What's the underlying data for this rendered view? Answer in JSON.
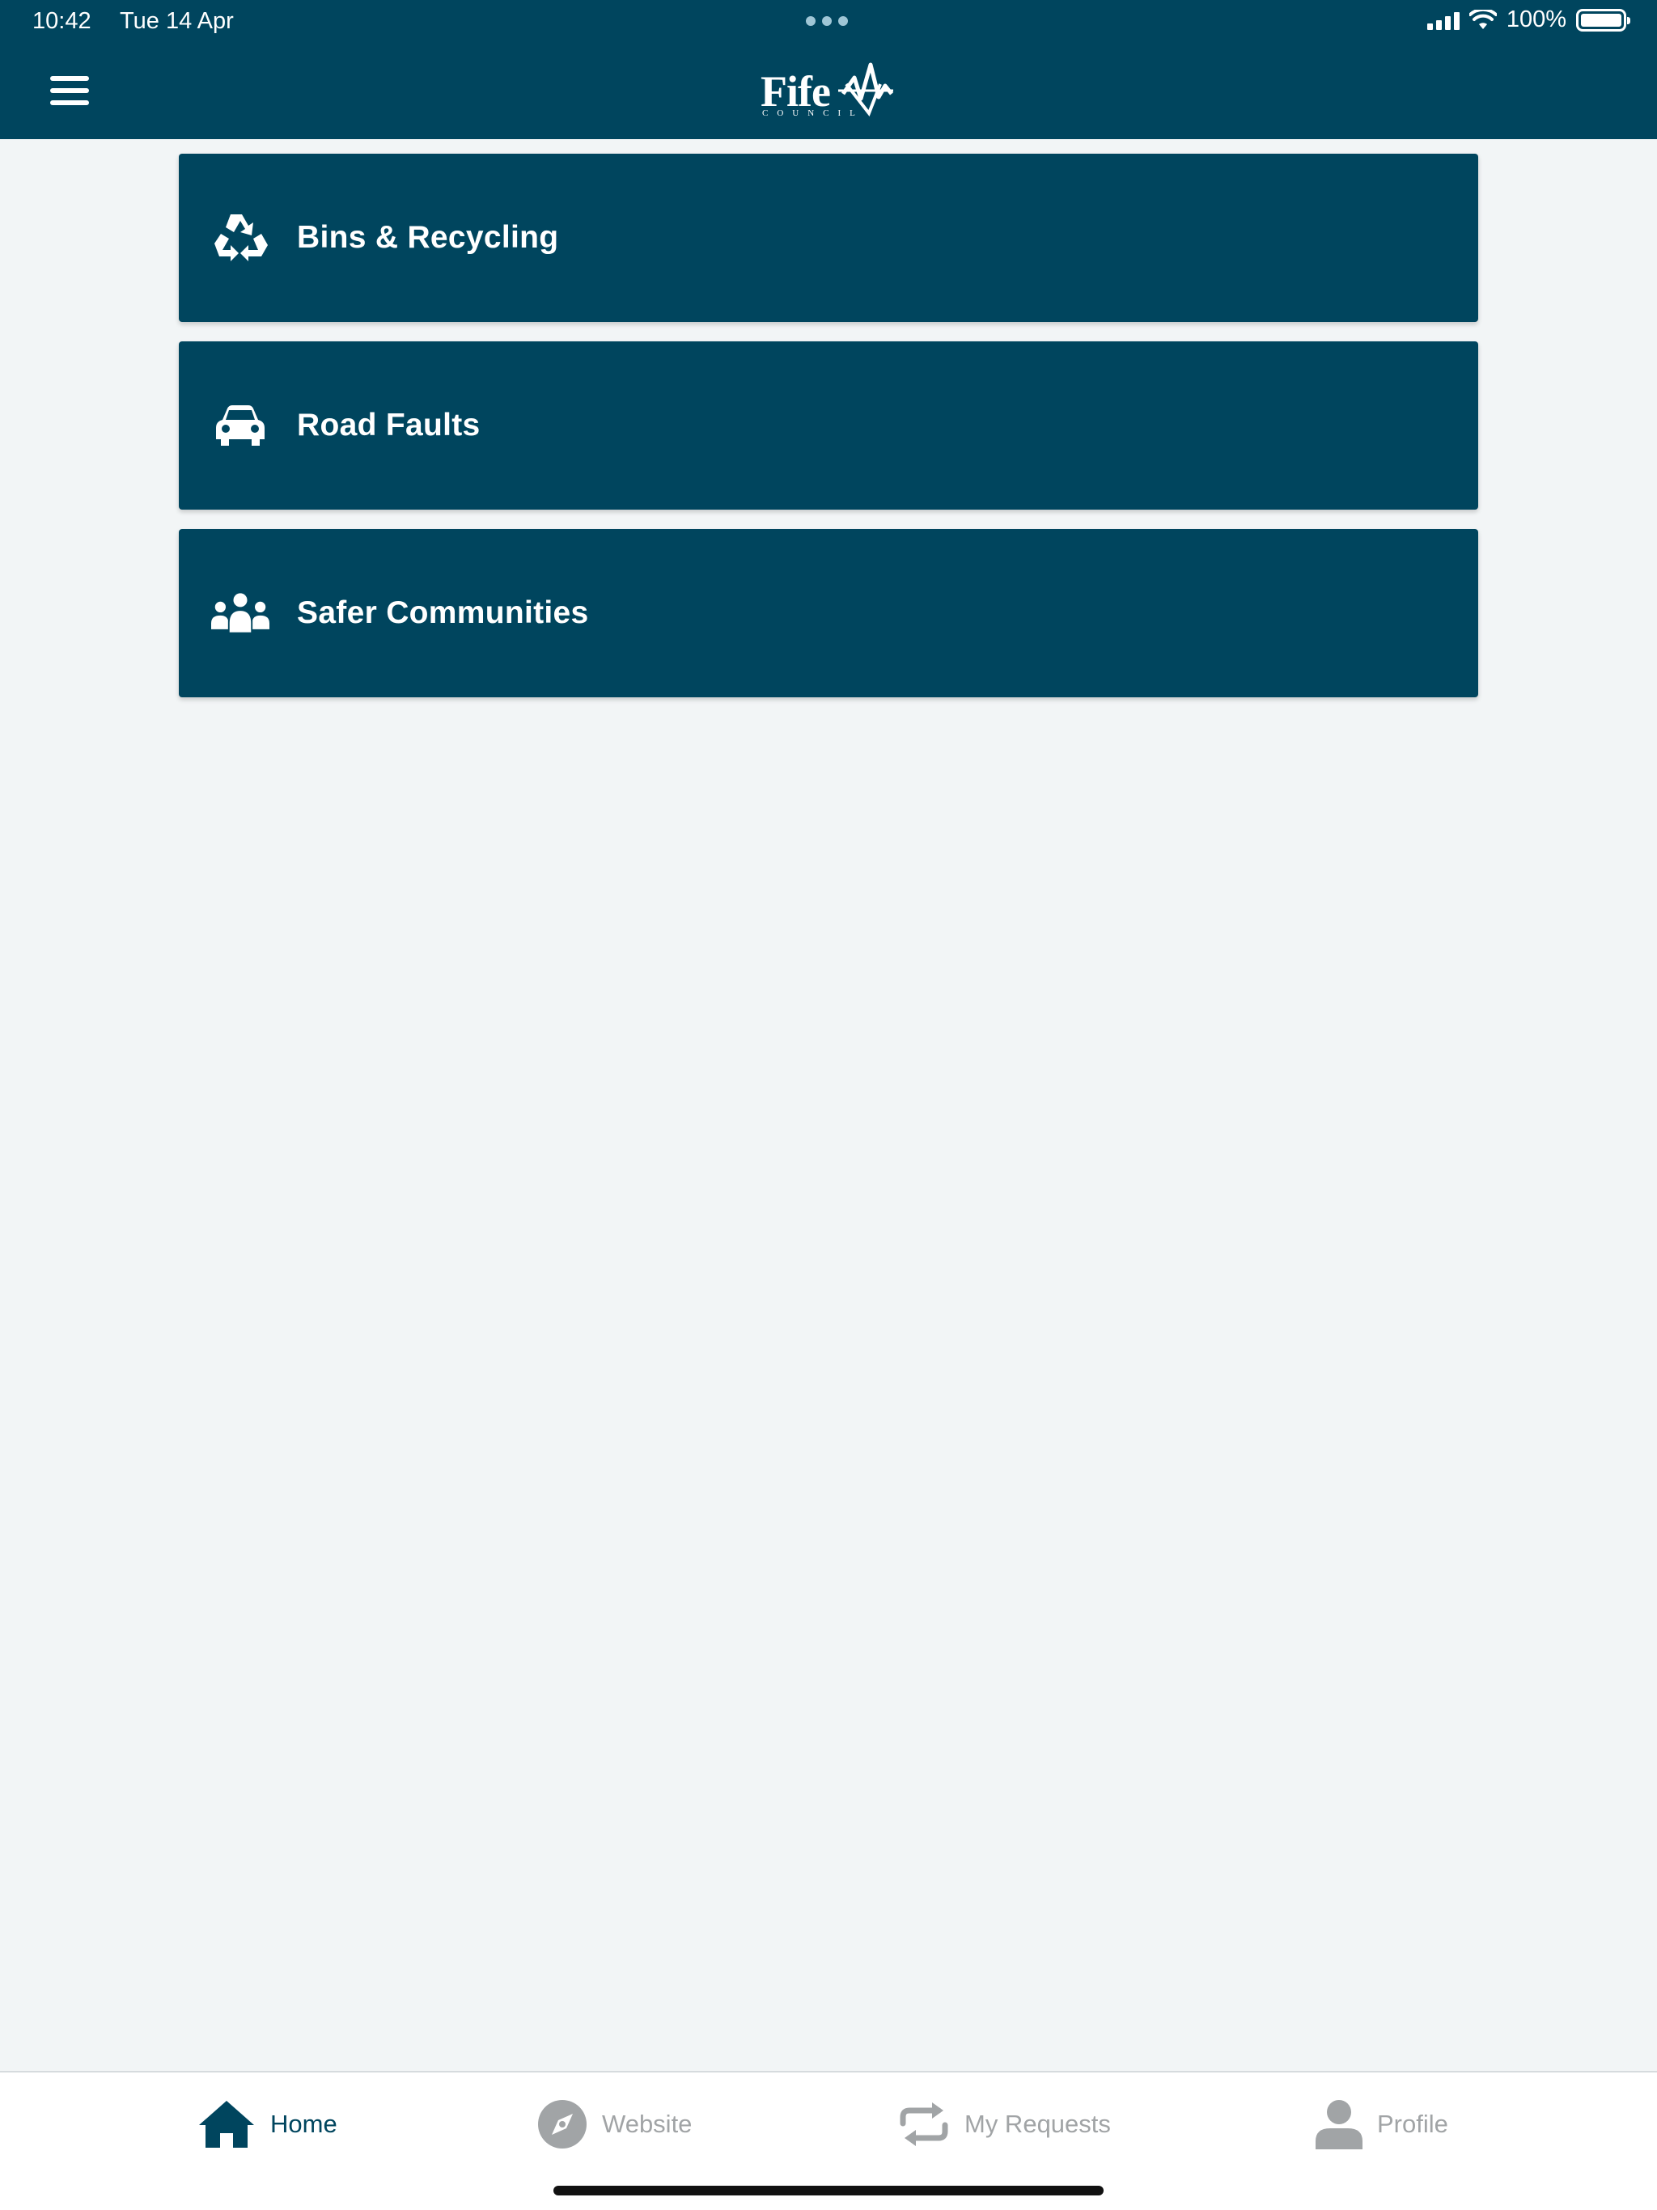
{
  "status_bar": {
    "time": "10:42",
    "date": "Tue 14 Apr",
    "battery": "100%"
  },
  "header": {
    "logo_text": "Fife",
    "logo_subtext": "COUNCIL",
    "menu_icon": "hamburger-menu-icon"
  },
  "cards": [
    {
      "label": "Bins & Recycling",
      "icon": "recycle-icon"
    },
    {
      "label": "Road Faults",
      "icon": "car-icon"
    },
    {
      "label": "Safer Communities",
      "icon": "people-group-icon"
    }
  ],
  "tabs": [
    {
      "label": "Home",
      "icon": "home-icon",
      "active": true
    },
    {
      "label": "Website",
      "icon": "compass-icon",
      "active": false
    },
    {
      "label": "My Requests",
      "icon": "repeat-arrows-icon",
      "active": false
    },
    {
      "label": "Profile",
      "icon": "person-icon",
      "active": false
    }
  ],
  "colors": {
    "brand": "#00455e",
    "background": "#f2f5f6",
    "tab_inactive": "#a1a4a6"
  }
}
